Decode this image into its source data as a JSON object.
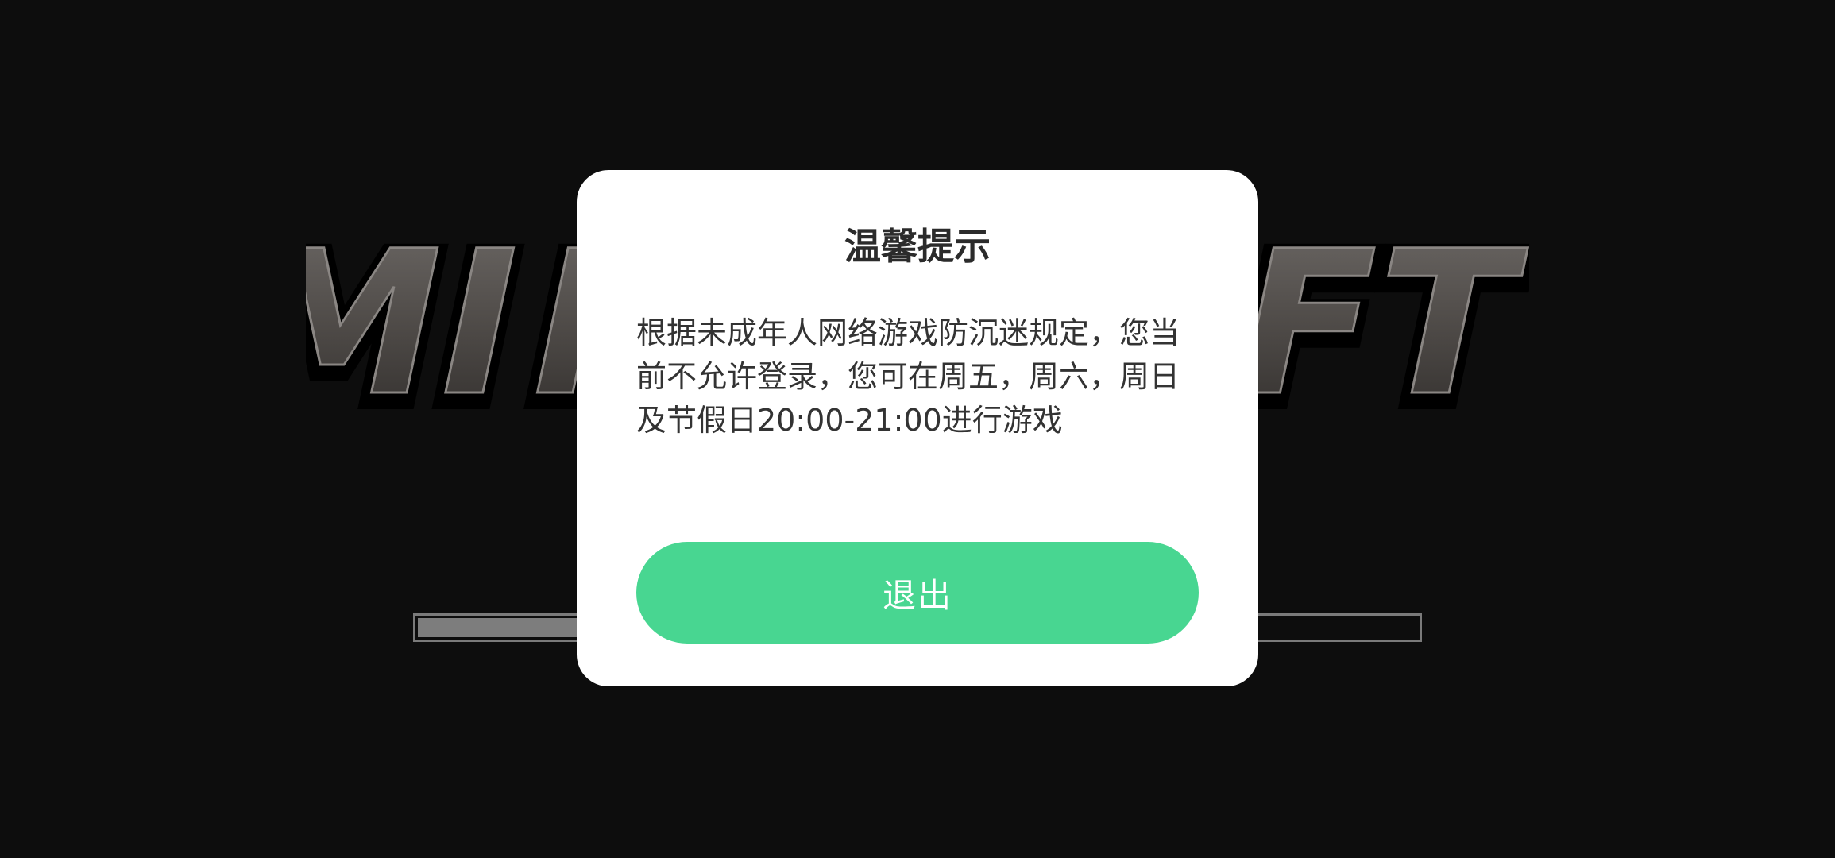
{
  "colors": {
    "background": "#0d0d0d",
    "dialog_bg": "#ffffff",
    "accent": "#48d691",
    "title_text": "#2b2b2b",
    "body_text": "#333333"
  },
  "logo": {
    "text": "MINECRAFT"
  },
  "loading": {
    "progress": 0.16
  },
  "dialog": {
    "title": "温馨提示",
    "message": "根据未成年人网络游戏防沉迷规定，您当前不允许登录，您可在周五，周六，周日及节假日20:00-21:00进行游戏",
    "exit_label": "退出"
  }
}
